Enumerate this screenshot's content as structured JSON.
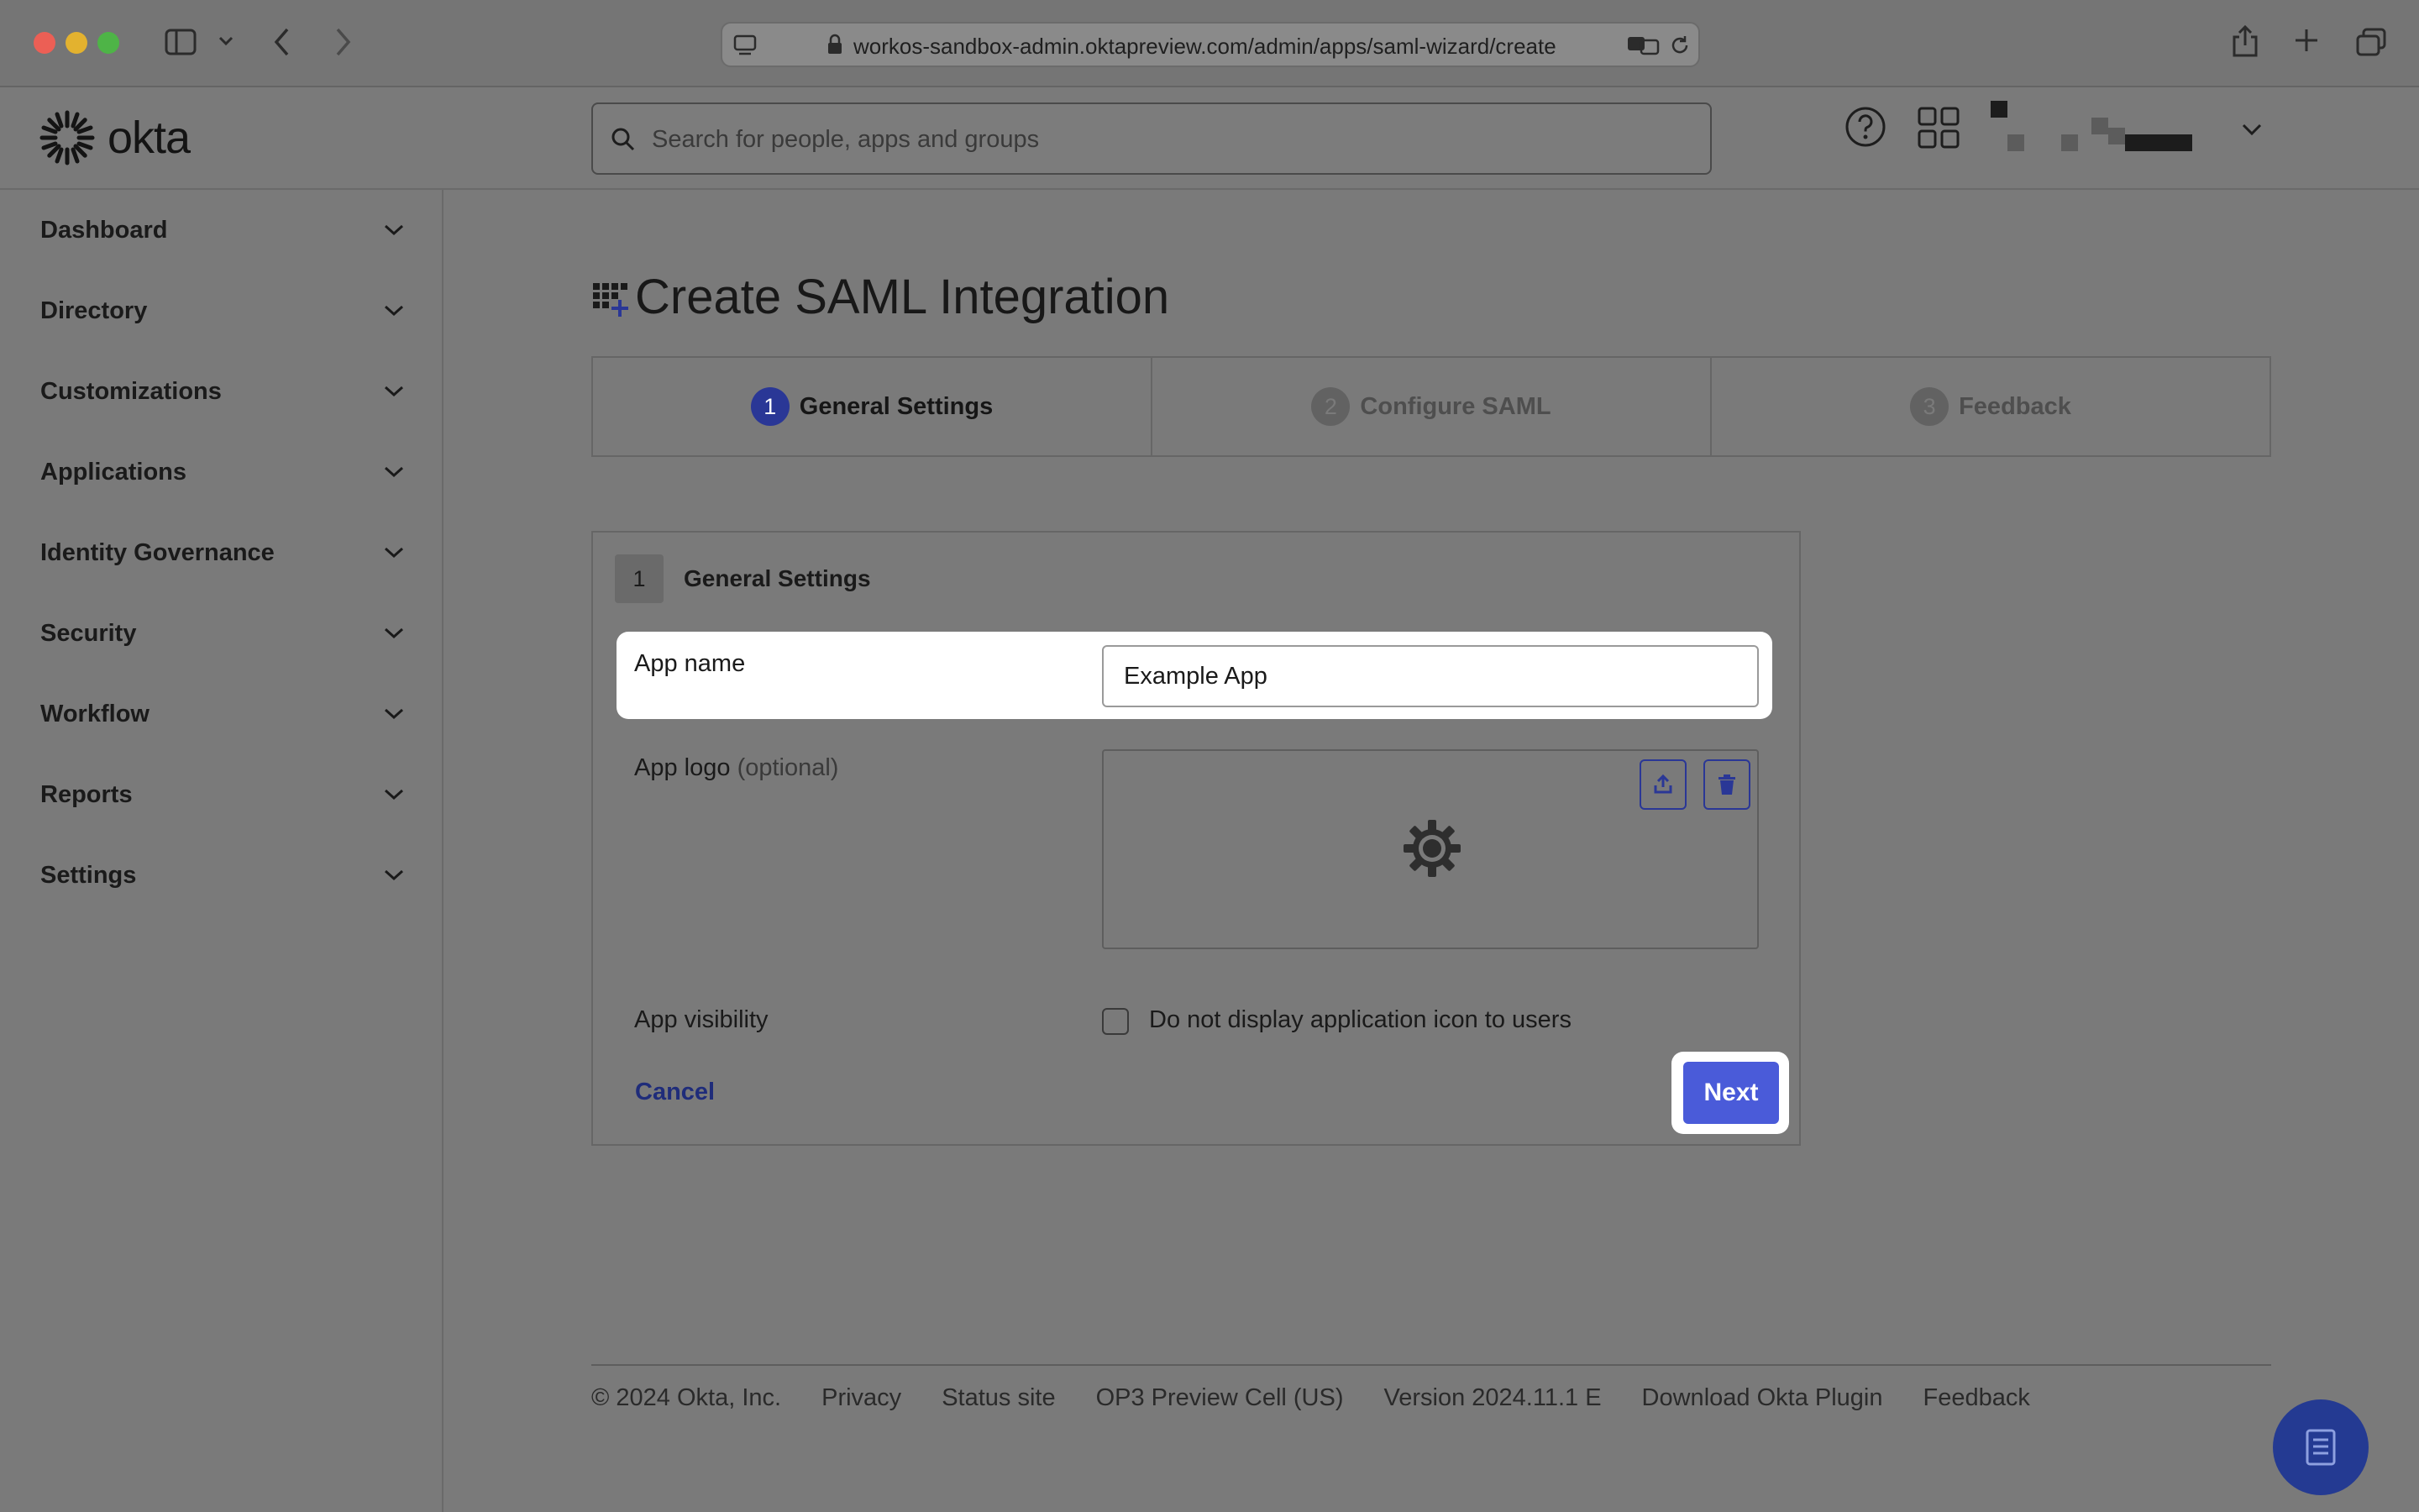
{
  "browser": {
    "url": "workos-sandbox-admin.oktapreview.com/admin/apps/saml-wizard/create"
  },
  "header": {
    "logo_text": "okta",
    "search_placeholder": "Search for people, apps and groups"
  },
  "sidebar": {
    "items": [
      {
        "label": "Dashboard"
      },
      {
        "label": "Directory"
      },
      {
        "label": "Customizations"
      },
      {
        "label": "Applications"
      },
      {
        "label": "Identity Governance"
      },
      {
        "label": "Security"
      },
      {
        "label": "Workflow"
      },
      {
        "label": "Reports"
      },
      {
        "label": "Settings"
      }
    ]
  },
  "page": {
    "title": "Create SAML Integration",
    "steps": [
      {
        "num": "1",
        "label": "General Settings",
        "active": true
      },
      {
        "num": "2",
        "label": "Configure SAML",
        "active": false
      },
      {
        "num": "3",
        "label": "Feedback",
        "active": false
      }
    ]
  },
  "form": {
    "section_num": "1",
    "section_title": "General Settings",
    "app_name_label": "App name",
    "app_name_value": "Example App",
    "app_logo_label": "App logo",
    "app_logo_optional": "(optional)",
    "visibility_label": "App visibility",
    "visibility_checkbox_label": "Do not display application icon to users",
    "visibility_checked": false,
    "cancel_label": "Cancel",
    "next_label": "Next"
  },
  "footer": {
    "copyright": "© 2024 Okta, Inc.",
    "privacy": "Privacy",
    "status": "Status site",
    "cell": "OP3 Preview Cell (US)",
    "version": "Version 2024.11.1 E",
    "plugin": "Download Okta Plugin",
    "feedback": "Feedback"
  },
  "colors": {
    "accent": "#4a5bd9",
    "step_active": "#2a3796",
    "link": "#1f2c7a",
    "help_fab": "#243a92"
  },
  "icons": {
    "sidebar_toggle": "sidebar-icon",
    "back": "chevron-left-icon",
    "forward": "chevron-right-icon",
    "lock": "lock-icon",
    "translate": "translate-icon",
    "reload": "reload-icon",
    "share": "share-icon",
    "new_tab": "plus-icon",
    "tabs": "tabs-overview-icon",
    "help": "help-icon",
    "apps_grid": "grid-icon",
    "upload": "upload-icon",
    "delete": "trash-icon",
    "placeholder_logo": "gear-icon",
    "help_fab": "document-icon"
  }
}
